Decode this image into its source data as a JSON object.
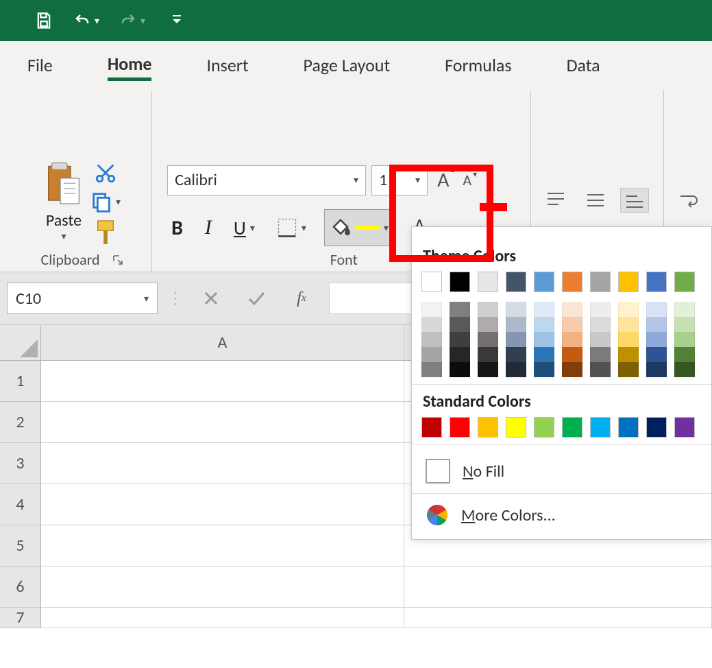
{
  "ribbon_tabs": {
    "file": "File",
    "home": "Home",
    "insert": "Insert",
    "page_layout": "Page Layout",
    "formulas": "Formulas",
    "data": "Data"
  },
  "clipboard": {
    "paste_label": "Paste",
    "group_label": "Clipboard"
  },
  "font": {
    "name": "Calibri",
    "size": "11",
    "group_label": "Font"
  },
  "name_box": "C10",
  "sheet": {
    "col_A": "A",
    "rows": [
      "1",
      "2",
      "3",
      "4",
      "5",
      "6",
      "7"
    ]
  },
  "picker": {
    "theme_title": "Theme Colors",
    "standard_title": "Standard Colors",
    "no_fill": "No Fill",
    "more_colors": "More Colors...",
    "theme_main": [
      "#ffffff",
      "#000000",
      "#e7e6e6",
      "#44546a",
      "#5b9bd5",
      "#ed7d31",
      "#a5a5a5",
      "#ffc000",
      "#4472c4",
      "#70ad47"
    ],
    "theme_shades": [
      [
        "#f2f2f2",
        "#7f7f7f",
        "#d0cece",
        "#d6dce4",
        "#deebf6",
        "#fbe5d5",
        "#ededed",
        "#fff2cc",
        "#d9e2f3",
        "#e2efd9"
      ],
      [
        "#d8d8d8",
        "#595959",
        "#aeabab",
        "#adb9ca",
        "#bdd7ee",
        "#f7cbac",
        "#dbdbdb",
        "#fee599",
        "#b4c6e7",
        "#c5e0b3"
      ],
      [
        "#bfbfbf",
        "#3f3f3f",
        "#757070",
        "#8496b0",
        "#9cc3e5",
        "#f4b183",
        "#c9c9c9",
        "#ffd965",
        "#8eaadb",
        "#a8d08d"
      ],
      [
        "#a5a5a5",
        "#262626",
        "#3a3838",
        "#323f4f",
        "#2e75b5",
        "#c55a11",
        "#7b7b7b",
        "#bf9000",
        "#2f5496",
        "#538135"
      ],
      [
        "#7f7f7f",
        "#0c0c0c",
        "#171616",
        "#222a35",
        "#1e4e79",
        "#833c0b",
        "#525252",
        "#7f6000",
        "#1f3864",
        "#375623"
      ]
    ],
    "standard": [
      "#c00000",
      "#ff0000",
      "#ffc000",
      "#ffff00",
      "#92d050",
      "#00b050",
      "#00b0f0",
      "#0070c0",
      "#002060",
      "#7030a0"
    ]
  }
}
